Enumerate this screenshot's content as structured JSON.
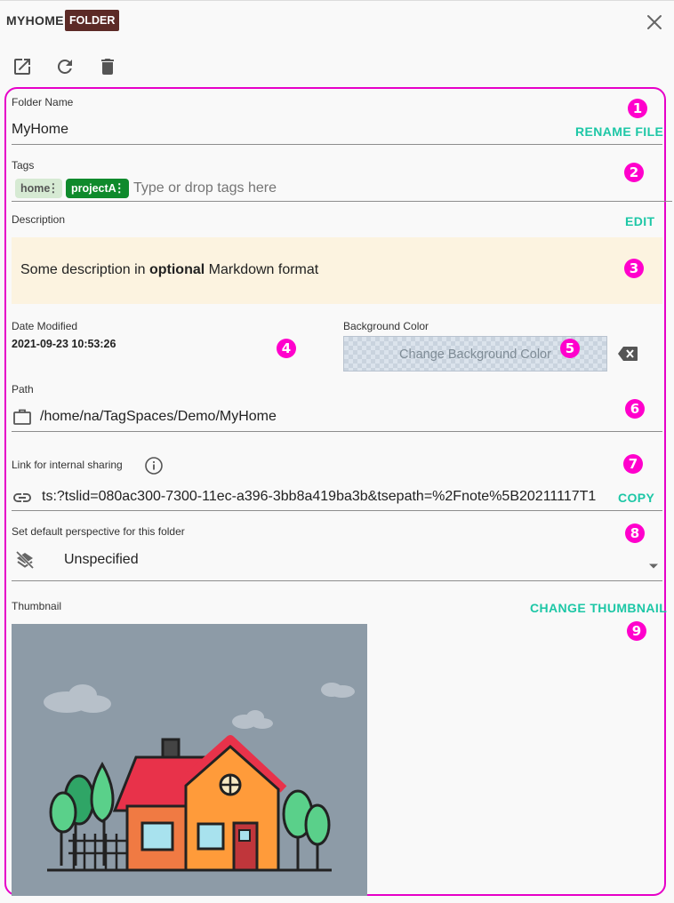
{
  "header": {
    "title": "MYHOME",
    "type_badge": "FOLDER",
    "close_icon": "close-icon",
    "toolbar": [
      "open-in-new-icon",
      "reload-icon",
      "delete-icon"
    ]
  },
  "folder_name": {
    "label": "Folder Name",
    "value": "MyHome",
    "rename_label": "RENAME FILE",
    "marker": "1"
  },
  "tags": {
    "label": "Tags",
    "items": [
      {
        "label": "home",
        "color": "#d6ead3",
        "text_color": "#555555"
      },
      {
        "label": "projectA",
        "color": "#0f8a2c",
        "text_color": "#ffffff"
      }
    ],
    "placeholder": "Type or drop tags here",
    "marker": "2"
  },
  "description": {
    "label": "Description",
    "edit_label": "EDIT",
    "text_before": "Some description in ",
    "text_bold": "optional",
    "text_after": " Markdown format",
    "marker": "3"
  },
  "date_modified": {
    "label": "Date Modified",
    "value": "2021-09-23 10:53:26",
    "marker": "4"
  },
  "background_color": {
    "label": "Background Color",
    "button_label": "Change Background Color",
    "clear_icon": "backspace-icon",
    "marker": "5"
  },
  "path": {
    "label": "Path",
    "value": "/home/na/TagSpaces/Demo/MyHome",
    "icon": "briefcase-icon",
    "marker": "6"
  },
  "sharing_link": {
    "label": "Link for internal sharing",
    "info_icon": "info-icon",
    "link_icon": "link-icon",
    "value": "ts:?tslid=080ac300-7300-11ec-a396-3bb8a419ba3b&tsepath=%2Fnote%5B20211117T1",
    "copy_label": "COPY",
    "marker": "7"
  },
  "perspective": {
    "label": "Set default perspective for this folder",
    "icon": "layers-off-icon",
    "selected": "Unspecified",
    "marker": "8"
  },
  "thumbnail": {
    "label": "Thumbnail",
    "change_label": "CHANGE THUMBNAIL",
    "marker": "9"
  },
  "colors": {
    "accent": "#1dc7a6",
    "marker": "#ff00cc",
    "badge": "#5c2a26",
    "description_bg": "#fcf3e0"
  }
}
